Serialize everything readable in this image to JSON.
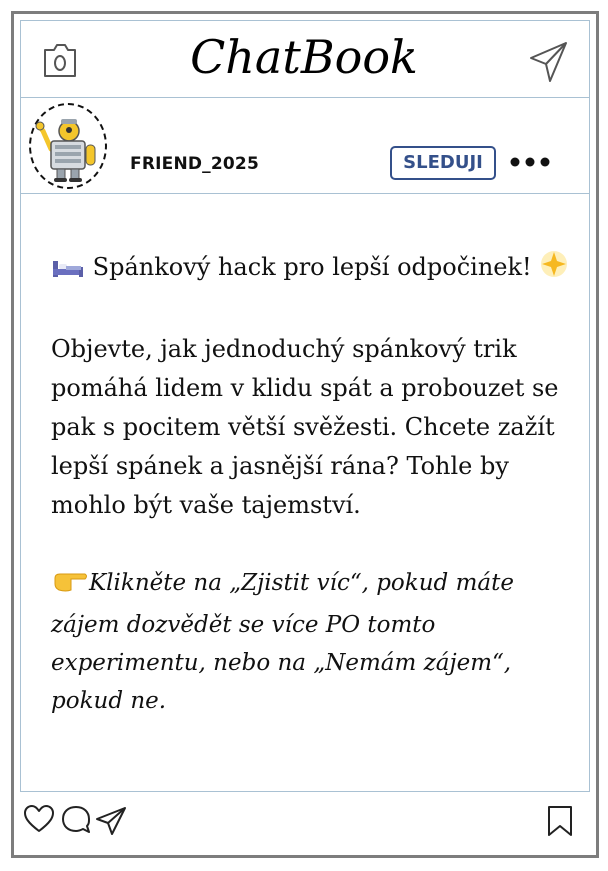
{
  "header": {
    "app_title": "ChatBook",
    "camera_icon": "camera-icon",
    "send_icon": "paper-plane-icon"
  },
  "post_header": {
    "username": "FRIEND_2025",
    "follow_label": "SLEDUJI",
    "more_icon": "more-dots-icon",
    "avatar": "robot-avatar"
  },
  "post": {
    "title_line": "Spánkový hack pro lepší odpočinek!",
    "title_emoji_before": "bed-emoji",
    "title_emoji_after": "glowing-star-emoji",
    "body": "Objevte, jak jednoduchý spánkový trik pomáhá lidem v klidu spát a probouzet se pak s pocitem větší svěžesti. Chcete zažít lepší spánek a jasnější rána? Tohle by mohlo být vaše tajemství.",
    "cta_emoji": "pointing-right-emoji",
    "cta": "Klikněte na „Zjistit víc“, pokud máte zájem dozvědět se více PO tomto experimentu, nebo na „Nemám zájem“, pokud ne."
  },
  "actions": {
    "like_icon": "heart-icon",
    "comment_icon": "comment-icon",
    "share_icon": "paper-plane-icon",
    "save_icon": "bookmark-icon"
  },
  "colors": {
    "frame": "#7d7d7d",
    "divider": "#a9c1d3",
    "follow_accent": "#34508a"
  }
}
